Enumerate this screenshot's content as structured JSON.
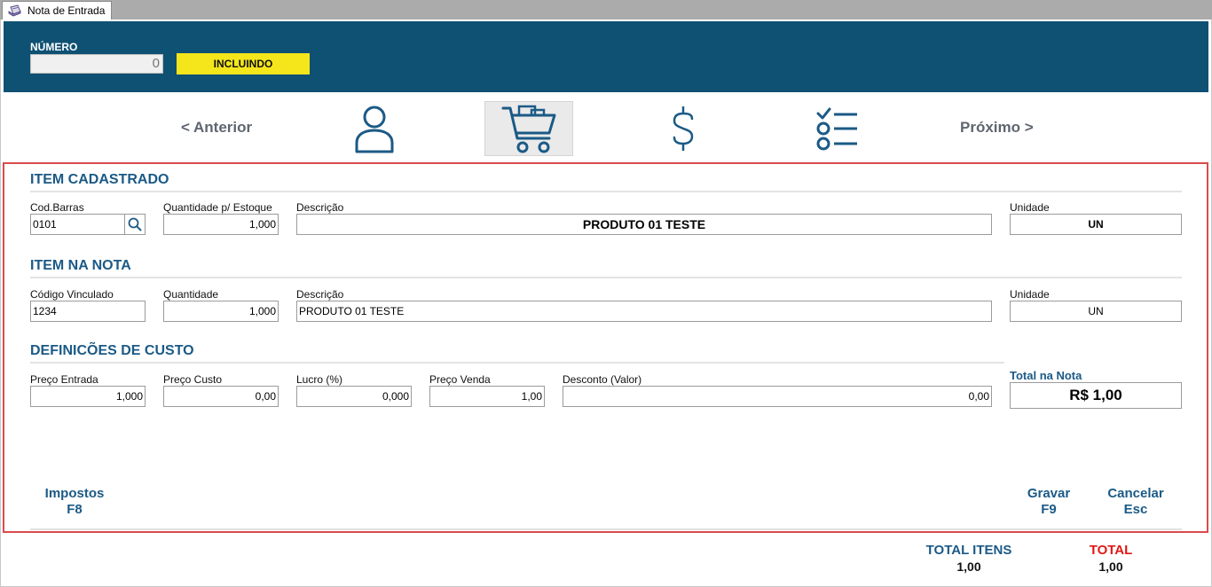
{
  "tab": {
    "label": "Nota de Entrada",
    "icon": "document-form-icon"
  },
  "header": {
    "numero_label": "NÚMERO",
    "numero_value": "0",
    "status": "INCLUINDO",
    "bg_color": "#0f5173",
    "status_color": "#f5e61c"
  },
  "nav": {
    "prev_label": "< Anterior",
    "next_label": "Próximo >",
    "steps": [
      {
        "icon": "person-icon",
        "active": false
      },
      {
        "icon": "shopping-cart-icon",
        "active": true
      },
      {
        "icon": "dollar-icon",
        "active": false
      },
      {
        "icon": "checklist-icon",
        "active": false
      }
    ]
  },
  "item_cadastrado": {
    "title": "ITEM CADASTRADO",
    "cod_barras_label": "Cod.Barras",
    "cod_barras_value": "0101",
    "quantidade_label": "Quantidade p/ Estoque",
    "quantidade_value": "1,000",
    "descricao_label": "Descrição",
    "descricao_value": "PRODUTO 01 TESTE",
    "unidade_label": "Unidade",
    "unidade_value": "UN"
  },
  "item_na_nota": {
    "title": "ITEM NA NOTA",
    "codigo_label": "Código Vinculado",
    "codigo_value": "1234",
    "quantidade_label": "Quantidade",
    "quantidade_value": "1,000",
    "descricao_label": "Descrição",
    "descricao_value": "PRODUTO 01 TESTE",
    "unidade_label": "Unidade",
    "unidade_value": "UN"
  },
  "custo": {
    "title": "DEFINICÕES DE CUSTO",
    "preco_entrada_label": "Preço Entrada",
    "preco_entrada_value": "1,000",
    "preco_custo_label": "Preço Custo",
    "preco_custo_value": "0,00",
    "lucro_label": "Lucro (%)",
    "lucro_value": "0,000",
    "preco_venda_label": "Preço Venda",
    "preco_venda_value": "1,00",
    "desconto_label": "Desconto (Valor)",
    "desconto_value": "0,00",
    "total_label": "Total na Nota",
    "total_value": "R$ 1,00"
  },
  "actions": {
    "impostos": {
      "label": "Impostos",
      "key": "F8"
    },
    "gravar": {
      "label": "Gravar",
      "key": "F9"
    },
    "cancelar": {
      "label": "Cancelar",
      "key": "Esc"
    }
  },
  "footer": {
    "total_itens_label": "TOTAL ITENS",
    "total_itens_value": "1,00",
    "total_label": "TOTAL",
    "total_value": "1,00",
    "total_color": "#e01818"
  }
}
